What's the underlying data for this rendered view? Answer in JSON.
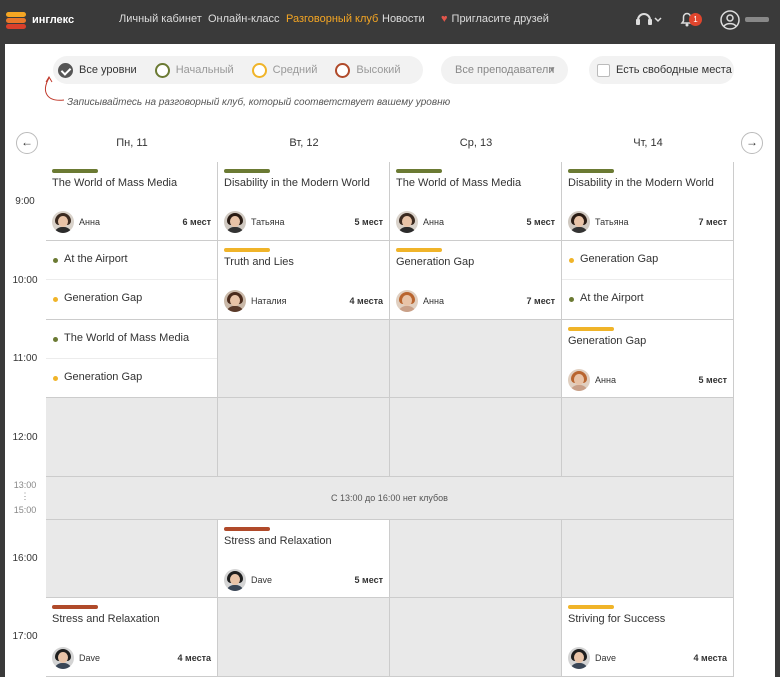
{
  "nav": {
    "logo_text": "инглекс",
    "items": [
      "Личный кабинет",
      "Онлайн-класс",
      "Разговорный клуб",
      "Новости",
      "Пригласите друзей"
    ],
    "active_item": "Разговорный клуб",
    "notifications_count": "1",
    "icons": [
      "headset-icon",
      "bell-icon",
      "user-icon"
    ]
  },
  "filters": {
    "levels": [
      "Все уровни",
      "Начальный",
      "Средний",
      "Высокий"
    ],
    "selected_level": "Все уровни",
    "teacher_select": "Все преподаватели",
    "free_places_label": "Есть свободные места",
    "hint": "Записывайтесь на разговорный клуб, который соответствует вашему уровню"
  },
  "colors": {
    "level_beginner": "#6b7a33",
    "level_middle": "#f0b429",
    "level_high": "#b04a2a",
    "accent": "#f5a623"
  },
  "calendar": {
    "days": [
      "Пн, 11",
      "Вт, 12",
      "Ср, 13",
      "Чт, 14"
    ],
    "times": [
      "9:00",
      "10:00",
      "11:00",
      "12:00",
      "13:00",
      "15:00",
      "16:00",
      "17:00"
    ],
    "break_text": "С 13:00 до 16:00 нет клубов",
    "slots": {
      "mon_9": {
        "title": "The World of Mass Media",
        "teacher": "Анна",
        "places": "6 мест"
      },
      "tue_9": {
        "title": "Disability in the Modern World",
        "teacher": "Татьяна",
        "places": "5 мест"
      },
      "wed_9": {
        "title": "The World of Mass Media",
        "teacher": "Анна",
        "places": "5 мест"
      },
      "thu_9": {
        "title": "Disability in the Modern World",
        "teacher": "Татьяна",
        "places": "7 мест"
      },
      "mon_10a": {
        "title": "At the Airport"
      },
      "mon_10b": {
        "title": "Generation Gap"
      },
      "tue_10": {
        "title": "Truth and Lies",
        "teacher": "Наталия",
        "places": "4 места"
      },
      "wed_10": {
        "title": "Generation Gap",
        "teacher": "Анна",
        "places": "7 мест"
      },
      "thu_10a": {
        "title": "Generation Gap"
      },
      "thu_10b": {
        "title": "At the Airport"
      },
      "mon_11a": {
        "title": "The World of Mass Media"
      },
      "mon_11b": {
        "title": "Generation Gap"
      },
      "thu_11": {
        "title": "Generation Gap",
        "teacher": "Анна",
        "places": "5 мест"
      },
      "tue_16": {
        "title": "Stress and Relaxation",
        "teacher": "Dave",
        "places": "5 мест"
      },
      "mon_17": {
        "title": "Stress and Relaxation",
        "teacher": "Dave",
        "places": "4 места"
      },
      "thu_17": {
        "title": "Striving for Success",
        "teacher": "Dave",
        "places": "4 места"
      }
    }
  }
}
